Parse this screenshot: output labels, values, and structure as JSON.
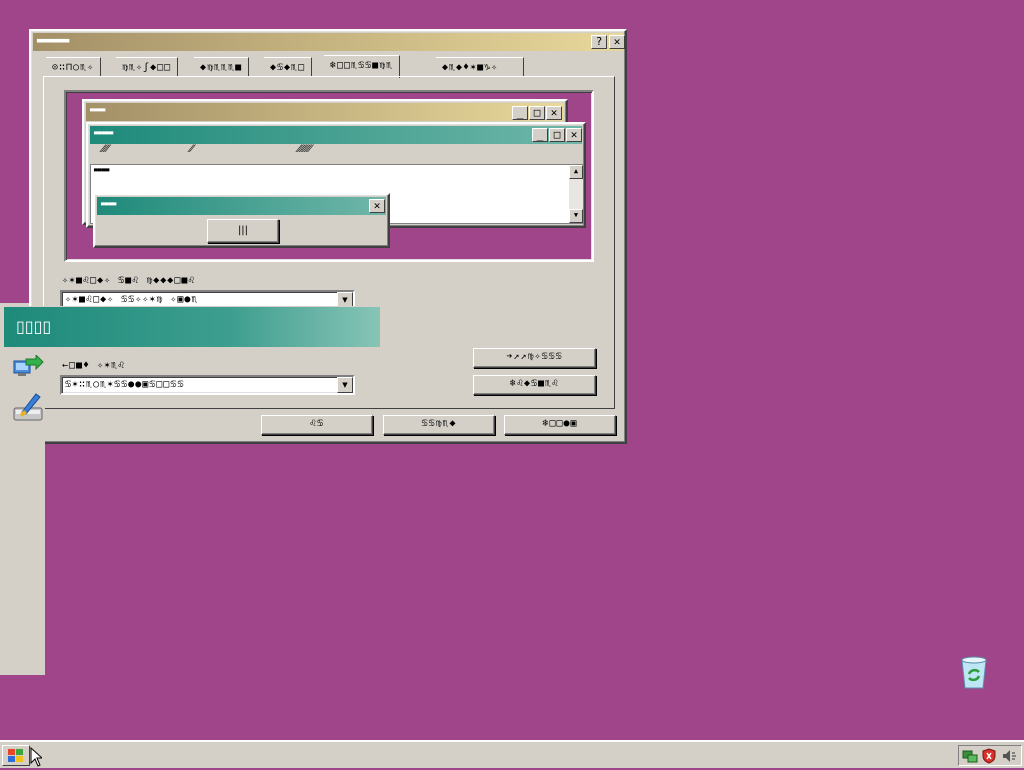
{
  "main_window": {
    "title": "▄▄▄▄▄▄▄",
    "help_btn": "?",
    "close_btn": "✕",
    "tabs": [
      {
        "label": "⊙∷⊓○♏✧"
      },
      {
        "label": "♍♏✧ʃ◆□□"
      },
      {
        "label": "◆♍♏♏♏■"
      },
      {
        "label": "◆♋◆♏□"
      },
      {
        "label": "❄□□♏♋♋■♍♏"
      },
      {
        "label": "◆♏◆♦✶■♑✧"
      }
    ],
    "preview": {
      "inactive_title": "▄▄▄▄",
      "active_title": "▄▄▄▄▄",
      "menu_items": [
        "⁄⁄⁄⁄",
        "⁄⁄",
        "⁄⁄⁄⁄⁄⁄⁄⁄"
      ],
      "window_text": "▄▄▄▄",
      "msgbox_title": "▄▄▄▄",
      "msgbox_btn": "|||"
    },
    "scheme_label": "✧✶■♌□◆✧  ♋■♌  ♍◆◆◆□■♌",
    "scheme_value": "✧✶■♌□◆✧  ♋♋✧✧✶♍  ✧▣●♏",
    "item_label": "←□■♦  ✧✶♏♌",
    "item_value": "♋✶∷♏○♏✶♋♋●●▣♋□□♋♋",
    "effects_btn": "➔↗↗♍✧♋♋♋",
    "advanced_btn": "❄♌◆♋■♏♌",
    "ok_btn": "♌♋",
    "cancel_btn": "♋♋♍♏◆",
    "apply_btn": "❄□□●▣"
  },
  "side_panel": {
    "banner": "▯▯▯▯",
    "icons": [
      "network-icon",
      "brush-icon"
    ]
  },
  "taskbar": {
    "start_icon": "windows-logo-icon",
    "tray_icons": [
      "network-status-icon",
      "security-shield-icon",
      "volume-icon"
    ]
  },
  "desktop": {
    "recycle_bin_icon": "recycle-bin-icon"
  },
  "colors": {
    "desktop": "#a0458a",
    "face": "#d4d0c8",
    "active_title": "#2a8f83",
    "inactive_title": "#c4ab76"
  }
}
